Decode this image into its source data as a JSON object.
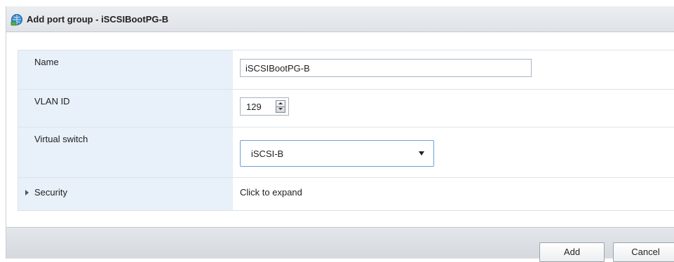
{
  "dialog": {
    "title": "Add port group - iSCSIBootPG-B",
    "title_icon": "port-group-icon"
  },
  "form": {
    "name": {
      "label": "Name",
      "value": "iSCSIBootPG-B"
    },
    "vlan": {
      "label": "VLAN ID",
      "value": "129"
    },
    "vswitch": {
      "label": "Virtual switch",
      "selected": "iSCSI-B"
    },
    "security": {
      "label": "Security",
      "hint": "Click to expand"
    }
  },
  "footer": {
    "add_label": "Add",
    "cancel_label": "Cancel"
  },
  "colors": {
    "label_bg": "#e8f0f9",
    "select_border": "#6ea0d6"
  }
}
